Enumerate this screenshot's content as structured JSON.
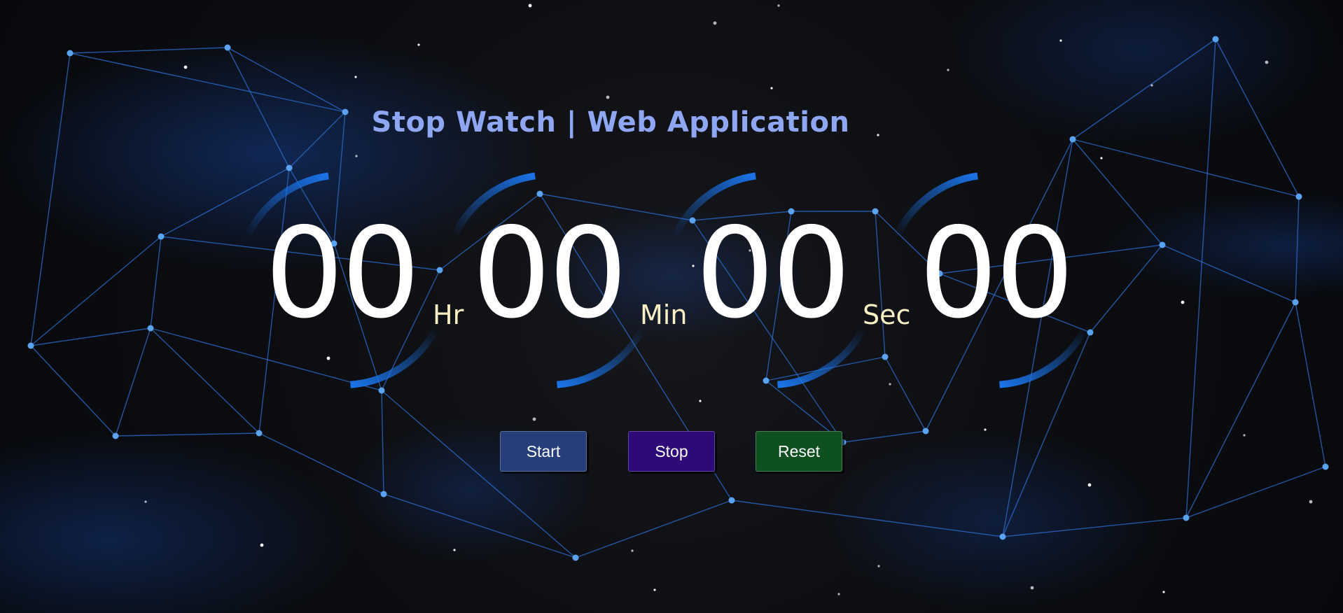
{
  "app": {
    "title": "Stop Watch | Web Application"
  },
  "timer": {
    "hours": "00",
    "minutes": "00",
    "seconds": "00",
    "centiseconds": "00",
    "hours_unit": "Hr",
    "minutes_unit": "Min",
    "seconds_unit": "Sec"
  },
  "controls": {
    "start_label": "Start",
    "stop_label": "Stop",
    "reset_label": "Reset"
  },
  "colors": {
    "title": "#8fa6f2",
    "digits": "#ffffff",
    "units": "#fbf0c4",
    "arc": "#1a73e8",
    "start_button": "#263f7a",
    "stop_button": "#2d0a78",
    "reset_button": "#0f5020",
    "network_lines": "#2c6fd1",
    "network_nodes": "#5aa3f0"
  }
}
